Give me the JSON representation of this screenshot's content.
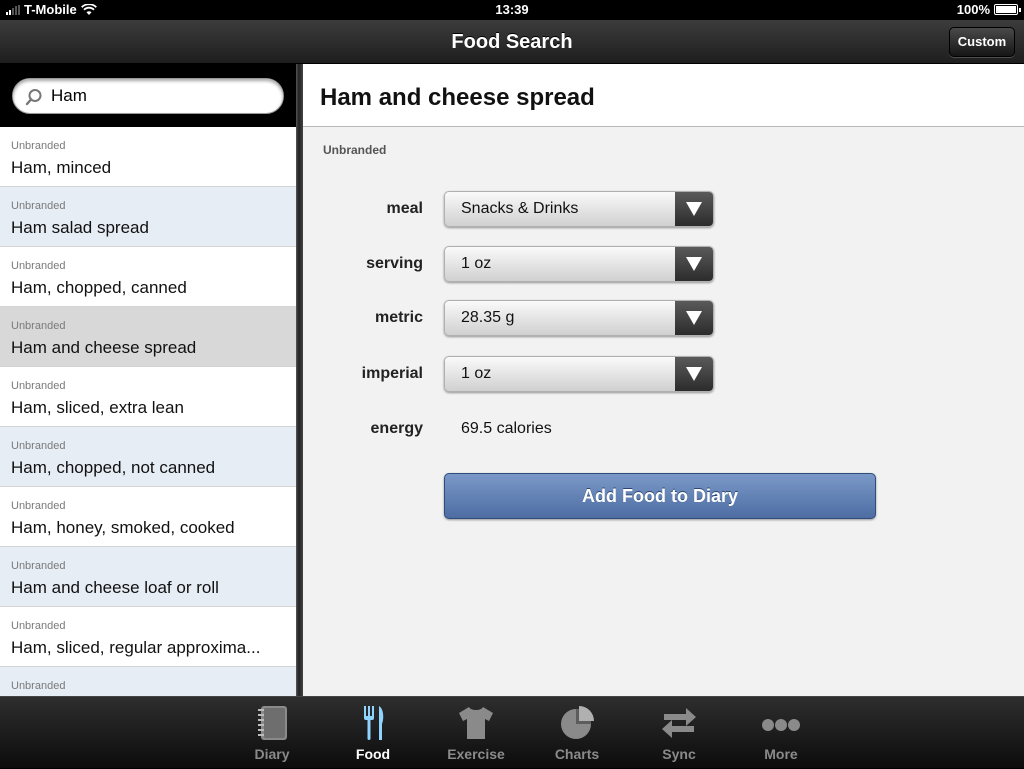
{
  "status_bar": {
    "carrier": "T-Mobile",
    "time": "13:39",
    "battery": "100%"
  },
  "nav": {
    "title": "Food Search",
    "custom_label": "Custom"
  },
  "search": {
    "value": "Ham",
    "placeholder": ""
  },
  "results": [
    {
      "brand": "Unbranded",
      "name": "Ham, minced"
    },
    {
      "brand": "Unbranded",
      "name": "Ham salad spread"
    },
    {
      "brand": "Unbranded",
      "name": "Ham, chopped, canned"
    },
    {
      "brand": "Unbranded",
      "name": "Ham and cheese spread"
    },
    {
      "brand": "Unbranded",
      "name": "Ham, sliced, extra lean"
    },
    {
      "brand": "Unbranded",
      "name": "Ham, chopped, not canned"
    },
    {
      "brand": "Unbranded",
      "name": "Ham, honey, smoked, cooked"
    },
    {
      "brand": "Unbranded",
      "name": "Ham and cheese loaf or roll"
    },
    {
      "brand": "Unbranded",
      "name": "Ham, sliced, regular approxima..."
    },
    {
      "brand": "Unbranded",
      "name": ""
    }
  ],
  "detail": {
    "title": "Ham and cheese spread",
    "brand": "Unbranded",
    "meal_label": "meal",
    "meal_value": "Snacks & Drinks",
    "serving_label": "serving",
    "serving_value": "1 oz",
    "metric_label": "metric",
    "metric_value": "28.35 g",
    "imperial_label": "imperial",
    "imperial_value": "1 oz",
    "energy_label": "energy",
    "energy_value": "69.5 calories",
    "add_button": "Add Food to Diary"
  },
  "tabs": [
    {
      "label": "Diary",
      "icon": "notebook-icon"
    },
    {
      "label": "Food",
      "icon": "fork-knife-icon"
    },
    {
      "label": "Exercise",
      "icon": "tshirt-icon"
    },
    {
      "label": "Charts",
      "icon": "pie-chart-icon"
    },
    {
      "label": "Sync",
      "icon": "sync-arrows-icon"
    },
    {
      "label": "More",
      "icon": "more-dots-icon"
    }
  ],
  "colors": {
    "accent_button": "#5b79ad",
    "alt_row": "#e6edf5",
    "selected_row": "#d8d8d8",
    "active_tab_icon": "#8fd3ff"
  }
}
